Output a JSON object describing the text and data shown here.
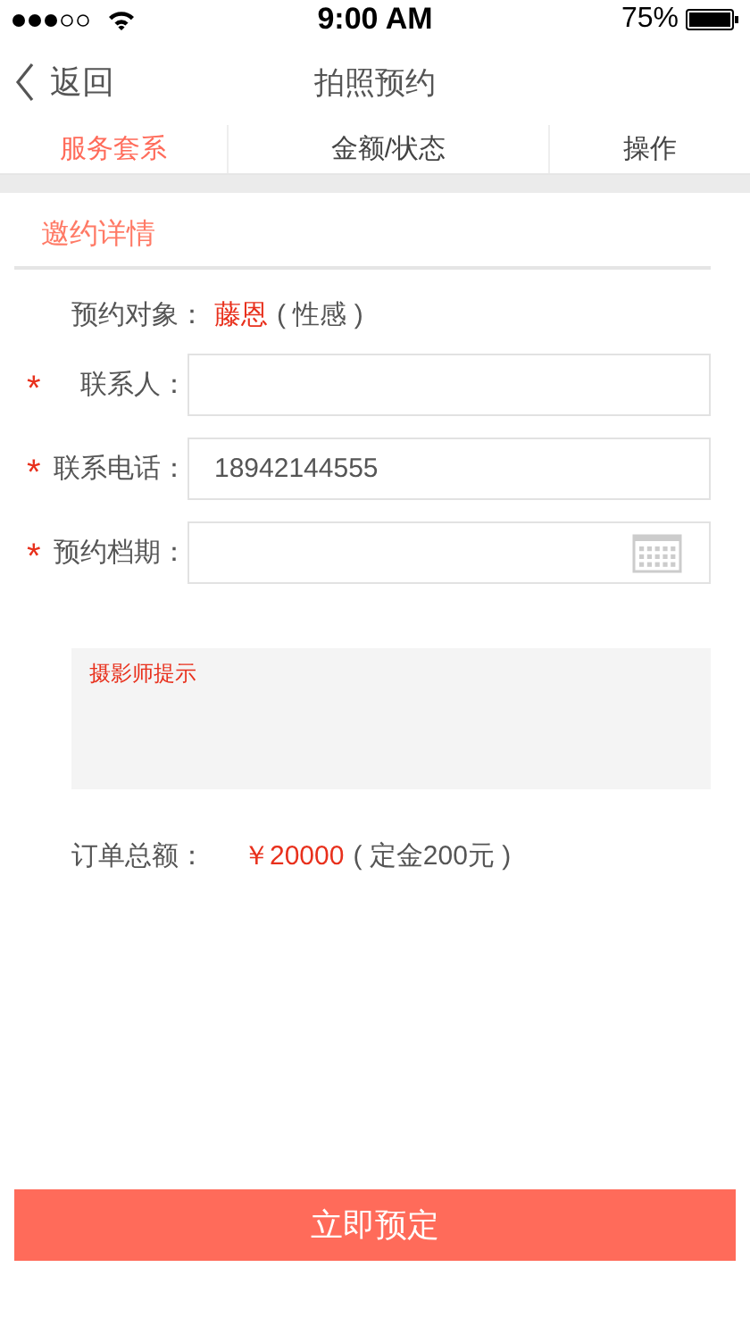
{
  "status_bar": {
    "time": "9:00 AM",
    "battery": "75%"
  },
  "nav": {
    "back": "返回",
    "title": "拍照预约"
  },
  "tabs": [
    {
      "label": "服务套系",
      "selected": true
    },
    {
      "label": "金额/状态",
      "selected": false
    },
    {
      "label": "操作",
      "selected": false
    }
  ],
  "section": {
    "title": "邀约详情"
  },
  "target": {
    "label": "预约对象：",
    "name": "藤恩",
    "note": "( 性感 )"
  },
  "fields": [
    {
      "kind": "text",
      "label": "联系人：",
      "required_mark": "*"
    },
    {
      "kind": "text",
      "label": "联系电话：",
      "required_mark": "*",
      "value": "18942144555"
    },
    {
      "kind": "date",
      "label": "预约档期：",
      "required_mark": "*"
    }
  ],
  "hint": {
    "placeholder": "摄影师提示"
  },
  "total": {
    "label": "订单总额：",
    "amount": "￥20000",
    "note": "( 定金200元 )"
  },
  "submit": "立即预定"
}
